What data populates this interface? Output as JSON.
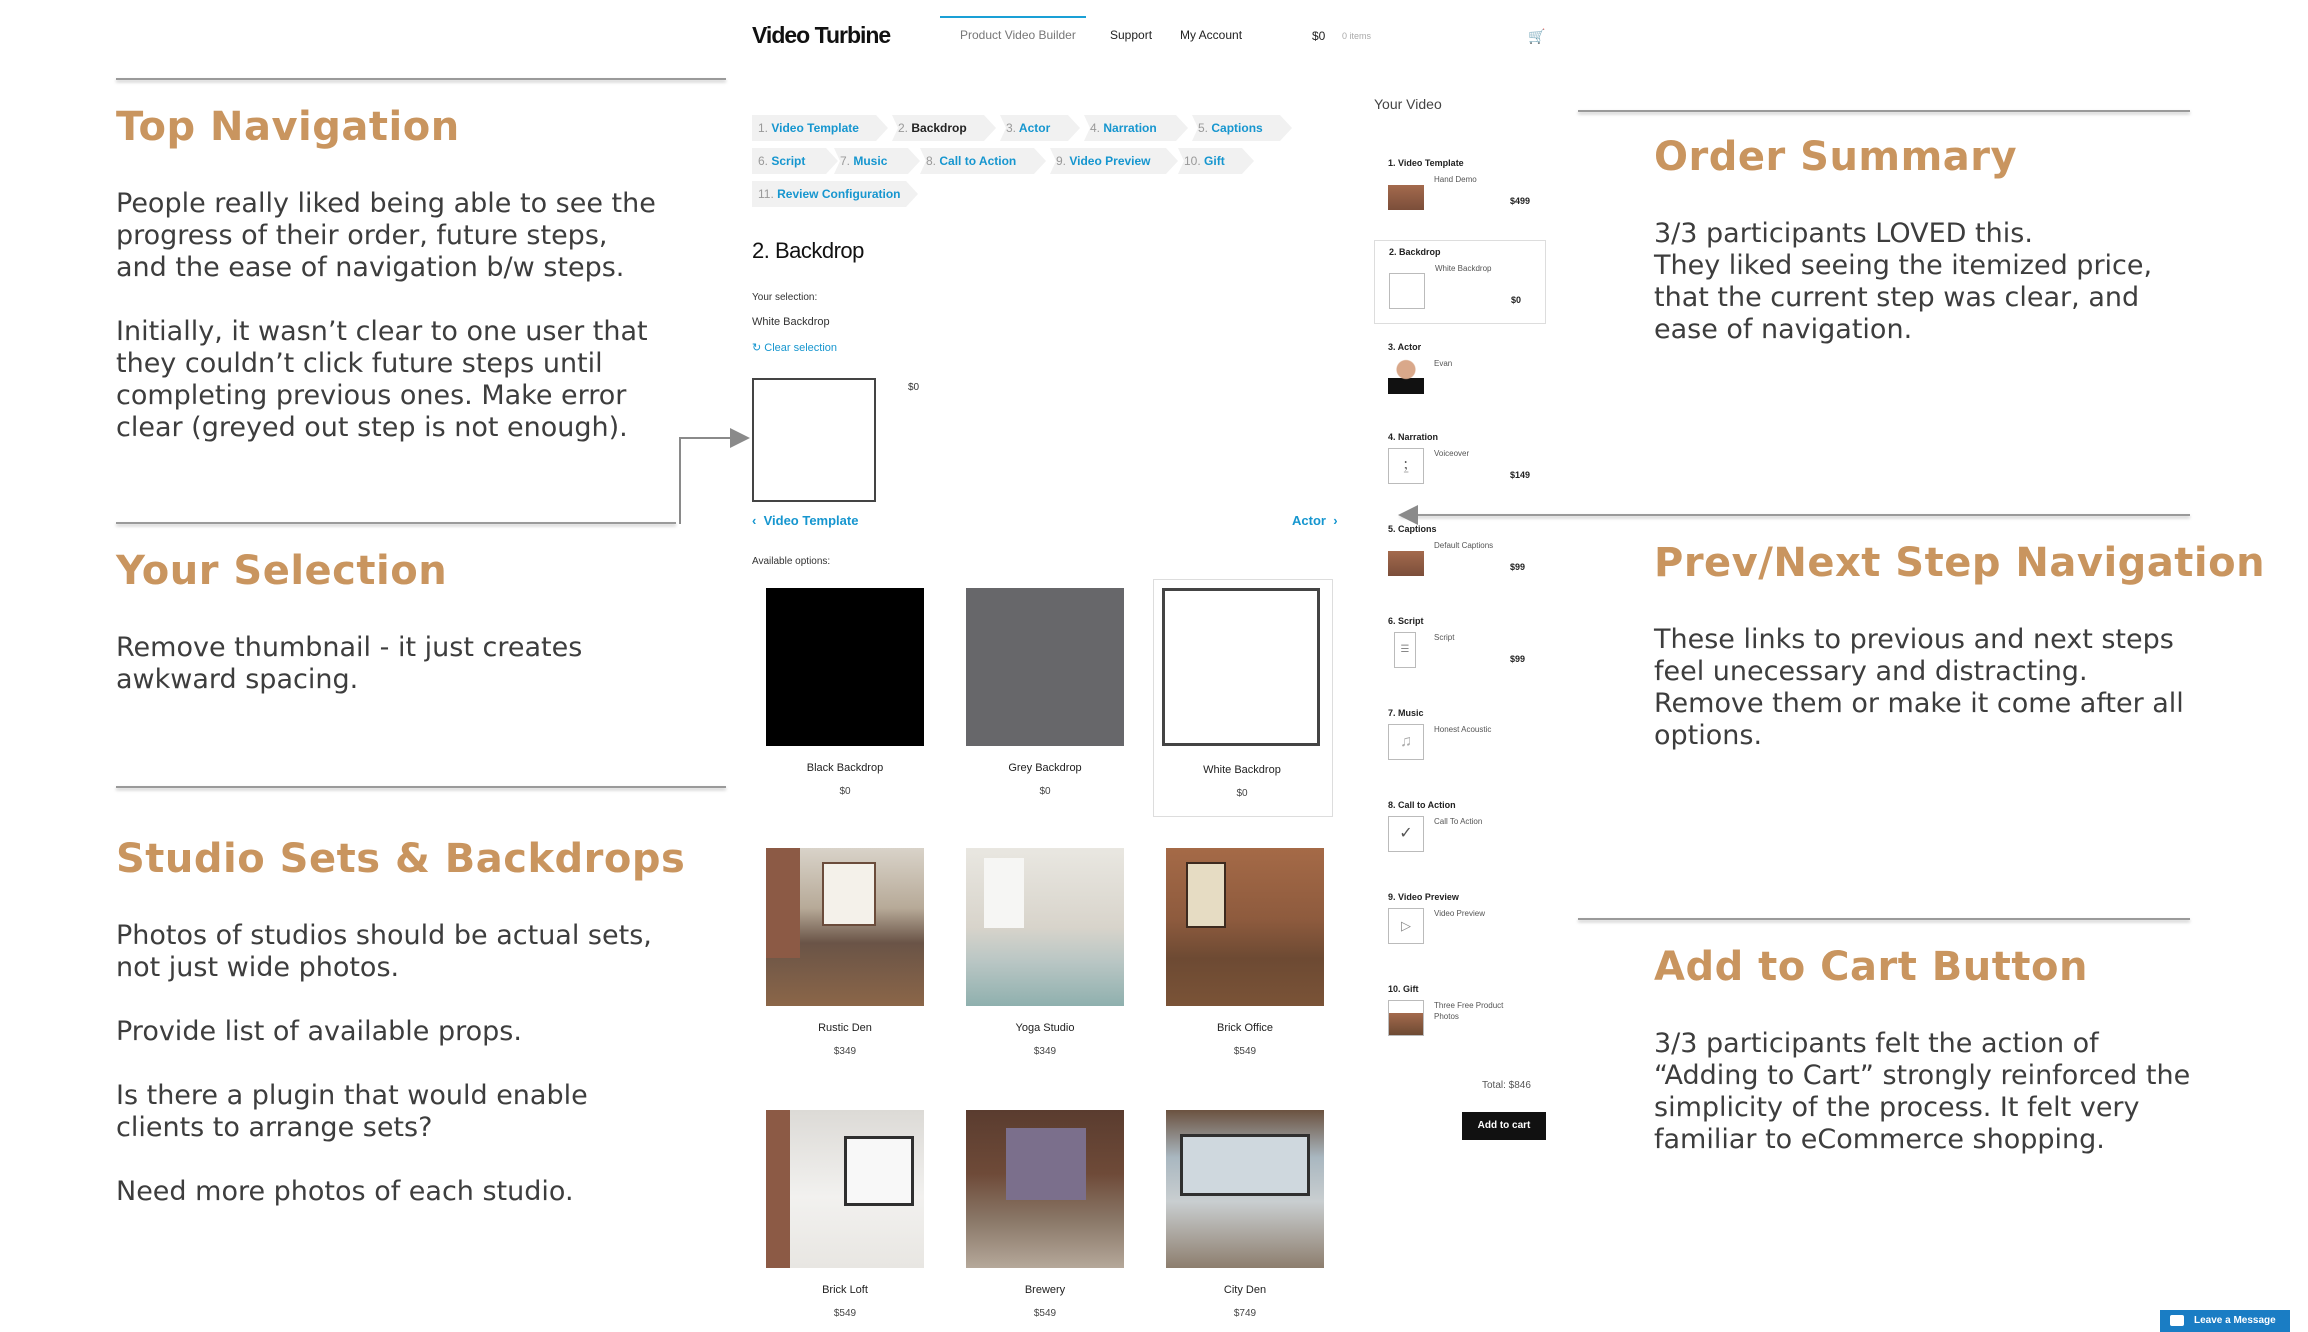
{
  "annotations": {
    "top_navigation": {
      "title": "Top Navigation",
      "paragraphs": [
        [
          "People really liked being able to see the",
          "progress of their order, future steps,",
          "and the ease of navigation b/w steps."
        ],
        [
          "Initially, it wasn’t clear to one user that",
          "they couldn’t click future steps until",
          "completing previous ones. Make error",
          "clear (greyed out step is not enough)."
        ]
      ]
    },
    "your_selection": {
      "title": "Your Selection",
      "paragraphs": [
        [
          "Remove thumbnail - it just creates",
          "awkward spacing."
        ]
      ]
    },
    "studio_sets": {
      "title": "Studio Sets & Backdrops",
      "paragraphs": [
        [
          "Photos of studios should be actual sets,",
          "not just wide photos."
        ],
        [
          "Provide list of available props."
        ],
        [
          "Is there a plugin that would enable",
          "clients to arrange sets?"
        ],
        [
          "Need more photos of each studio."
        ]
      ]
    },
    "order_summary": {
      "title": "Order Summary",
      "paragraphs": [
        [
          "3/3 participants LOVED this.",
          "They liked seeing the itemized price,",
          "that the current step was clear, and",
          "ease of navigation."
        ]
      ]
    },
    "prev_next": {
      "title": "Prev/Next Step Navigation",
      "paragraphs": [
        [
          "These links to previous and next steps",
          "feel unecessary and distracting.",
          "Remove them or make it come after all",
          "options."
        ]
      ]
    },
    "add_to_cart": {
      "title": "Add to Cart Button",
      "paragraphs": [
        [
          "3/3 participants felt the action of",
          "“Adding to Cart” strongly reinforced the",
          "simplicity of the process. It felt very",
          "familiar to eCommerce shopping."
        ]
      ]
    }
  },
  "app": {
    "logo": "Video Turbine",
    "nav": [
      "Product Video Builder",
      "Support",
      "My Account"
    ],
    "cart_total": "$0",
    "cart_items": "0 items",
    "steps": [
      {
        "num": "1.",
        "label": "Video Template"
      },
      {
        "num": "2.",
        "label": "Backdrop"
      },
      {
        "num": "3.",
        "label": "Actor"
      },
      {
        "num": "4.",
        "label": "Narration"
      },
      {
        "num": "5.",
        "label": "Captions"
      },
      {
        "num": "6.",
        "label": "Script"
      },
      {
        "num": "7.",
        "label": "Music"
      },
      {
        "num": "8.",
        "label": "Call to Action"
      },
      {
        "num": "9.",
        "label": "Video Preview"
      },
      {
        "num": "10.",
        "label": "Gift"
      },
      {
        "num": "11.",
        "label": "Review Configuration"
      }
    ],
    "section_title": "2. Backdrop",
    "your_selection_label": "Your selection:",
    "selection_value": "White Backdrop",
    "clear_selection": "Clear selection",
    "selection_price": "$0",
    "prev_link": "Video Template",
    "next_link": "Actor",
    "available_label": "Available options:",
    "options": [
      {
        "name": "Black Backdrop",
        "price": "$0"
      },
      {
        "name": "Grey Backdrop",
        "price": "$0"
      },
      {
        "name": "White Backdrop",
        "price": "$0"
      },
      {
        "name": "Rustic Den",
        "price": "$349"
      },
      {
        "name": "Yoga Studio",
        "price": "$349"
      },
      {
        "name": "Brick Office",
        "price": "$549"
      },
      {
        "name": "Brick Loft",
        "price": "$549"
      },
      {
        "name": "Brewery",
        "price": "$549"
      },
      {
        "name": "City Den",
        "price": "$749"
      }
    ],
    "sidebar": {
      "heading": "Your Video",
      "items": [
        {
          "title": "1. Video Template",
          "name": "Hand Demo",
          "price": "$499"
        },
        {
          "title": "2. Backdrop",
          "name": "White Backdrop",
          "price": "$0"
        },
        {
          "title": "3. Actor",
          "name": "Evan",
          "price": ""
        },
        {
          "title": "4. Narration",
          "name": "Voiceover",
          "price": "$149"
        },
        {
          "title": "5. Captions",
          "name": "Default Captions",
          "price": "$99"
        },
        {
          "title": "6. Script",
          "name": "Script",
          "price": "$99"
        },
        {
          "title": "7. Music",
          "name": "Honest Acoustic",
          "price": ""
        },
        {
          "title": "8. Call to Action",
          "name": "Call To Action",
          "price": ""
        },
        {
          "title": "9. Video Preview",
          "name": "Video Preview",
          "price": ""
        },
        {
          "title": "10. Gift",
          "name": "Three Free Product Photos",
          "price": ""
        }
      ],
      "total": "Total: $846",
      "add_to_cart": "Add to cart"
    },
    "leave_message": "Leave a Message"
  },
  "colors": {
    "annotation_title": "#c9955f",
    "link_blue": "#1696cf",
    "active_nav": "#1aa0d6"
  }
}
